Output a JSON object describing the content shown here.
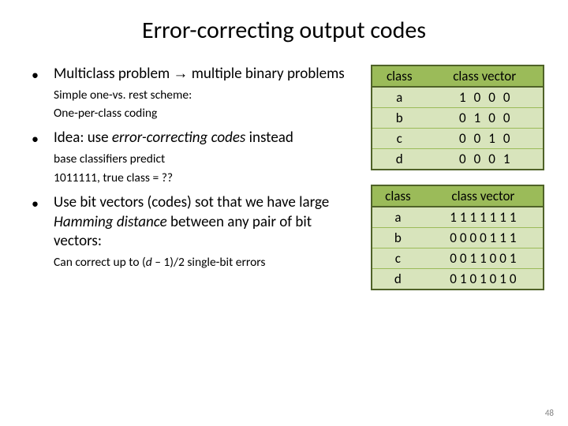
{
  "title": "Error-correcting output codes",
  "bullets": [
    {
      "main_pre": "Multiclass problem ",
      "arrow": "→",
      "main_post": " multiple binary problems",
      "sub1": "Simple one-vs. rest scheme:",
      "sub2": "One-per-class coding"
    },
    {
      "main_pre": "Idea: use ",
      "main_em": "error-correcting codes",
      "main_post": " instead",
      "sub1": "base classifiers predict",
      "sub2": "1011111, true class = ??"
    },
    {
      "main_pre": "Use bit vectors (codes) sot that we have large ",
      "main_em": "Hamming distance",
      "main_post": " between any pair of bit vectors:",
      "sub_pre": "Can correct up to (",
      "sub_em": "d",
      "sub_post": " – 1)/2 single-bit errors"
    }
  ],
  "table1": {
    "h1": "class",
    "h2": "class vector",
    "rows": [
      {
        "c": "a",
        "v": "1000"
      },
      {
        "c": "b",
        "v": "0100"
      },
      {
        "c": "c",
        "v": "0010"
      },
      {
        "c": "d",
        "v": "0001"
      }
    ]
  },
  "table2": {
    "h1": "class",
    "h2": "class vector",
    "rows": [
      {
        "c": "a",
        "v": "1111111"
      },
      {
        "c": "b",
        "v": "0000111"
      },
      {
        "c": "c",
        "v": "0011001"
      },
      {
        "c": "d",
        "v": "0101010"
      }
    ]
  },
  "page": "48"
}
